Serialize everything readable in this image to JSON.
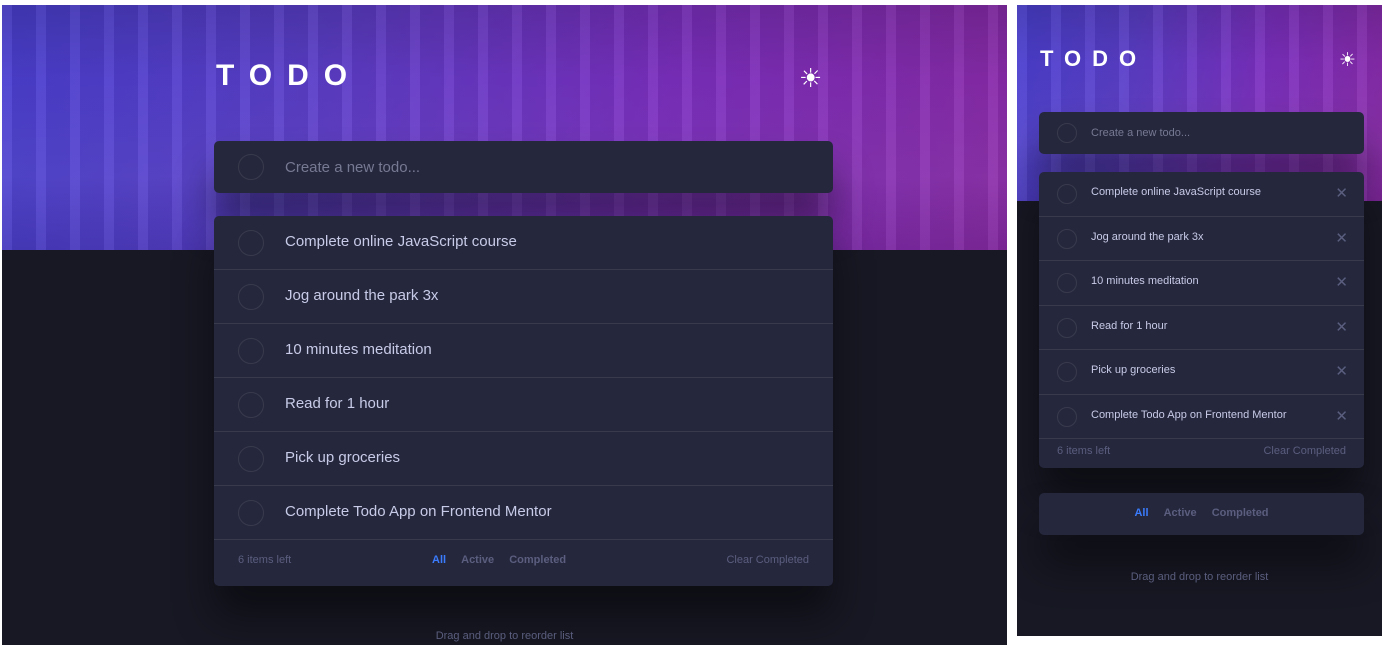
{
  "app": {
    "title": "TODO",
    "theme_icon": "sun-icon",
    "theme_glyph": "☀"
  },
  "input": {
    "placeholder": "Create a new todo..."
  },
  "todos": [
    {
      "label": "Complete online JavaScript course"
    },
    {
      "label": "Jog around the park 3x"
    },
    {
      "label": "10 minutes meditation"
    },
    {
      "label": "Read for 1 hour"
    },
    {
      "label": "Pick up groceries"
    },
    {
      "label": "Complete Todo App on Frontend Mentor"
    }
  ],
  "footer": {
    "items_left": "6 items left",
    "clear_completed": "Clear Completed"
  },
  "filters": {
    "all": "All",
    "active": "Active",
    "completed": "Completed",
    "selected": "all"
  },
  "hint": "Drag and drop to reorder list",
  "delete_glyph": "✕",
  "colors": {
    "background": "#171823",
    "card": "#25273d",
    "text": "#c8cbe7",
    "muted": "#5b5e7e",
    "accent": "#3a7cfd",
    "hero_start": "#4a3fd0",
    "hero_end": "#8a2aa8"
  }
}
